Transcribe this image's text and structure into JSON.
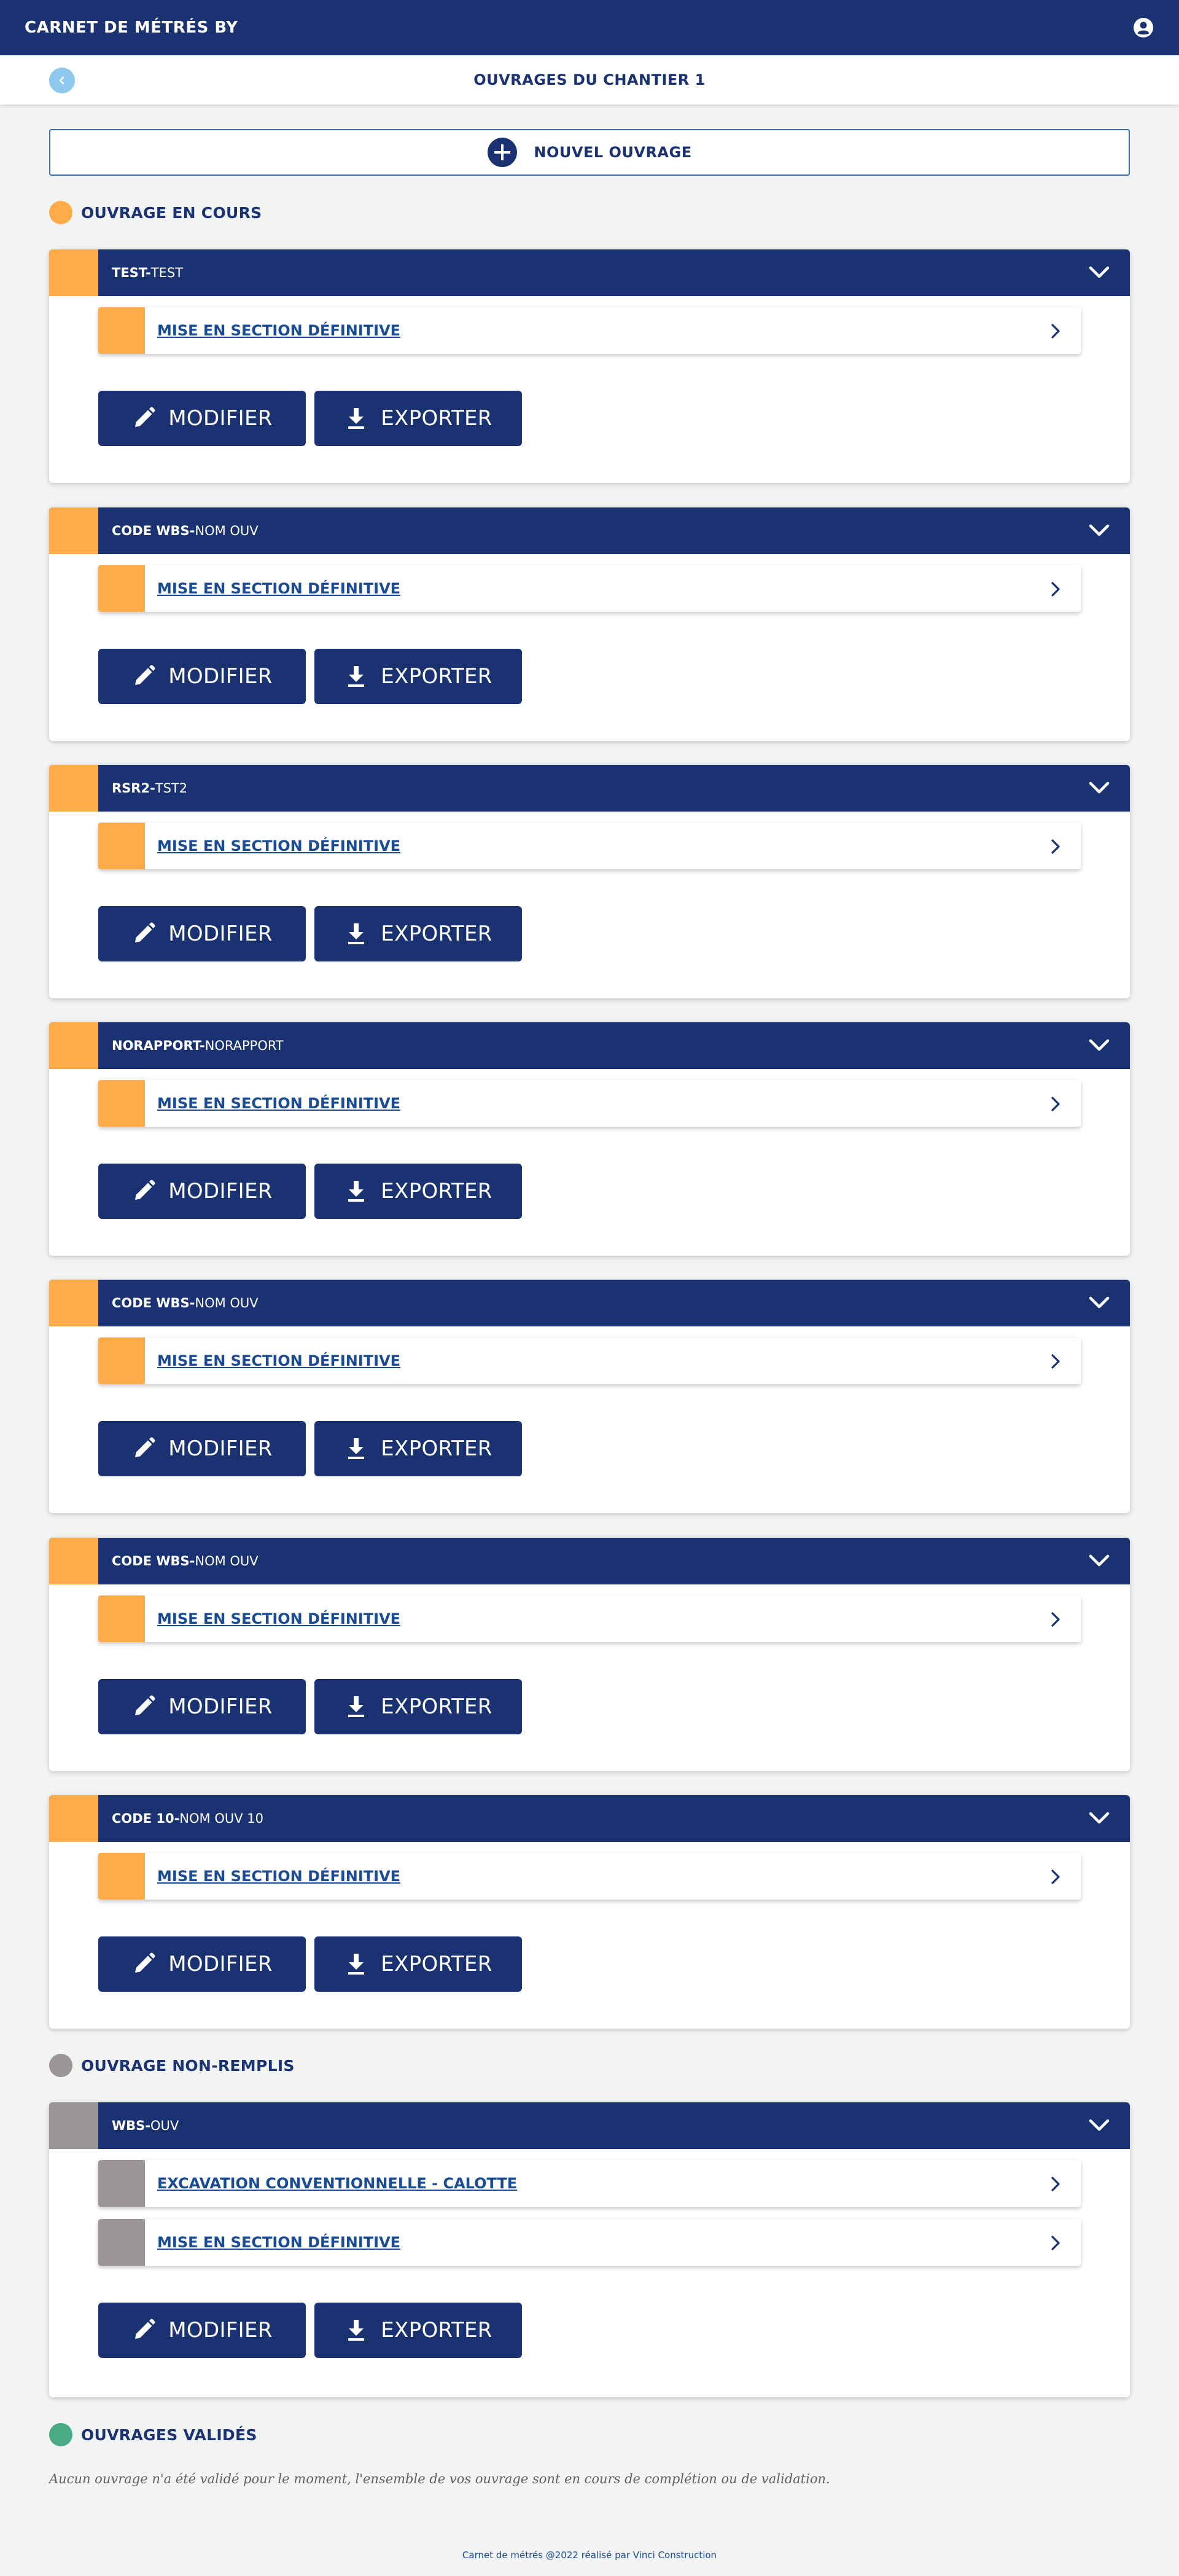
{
  "app": {
    "title": "CARNET DE MÉTRÉS BY"
  },
  "subheader": {
    "title": "OUVRAGES DU CHANTIER 1"
  },
  "new_ouvrage": {
    "label": "NOUVEL OUVRAGE"
  },
  "colors": {
    "primary": "#1a3272",
    "in_progress": "#ffab48",
    "empty": "#9b9595",
    "validated": "#4aaa85",
    "back": "#8ec8ee"
  },
  "sections": {
    "in_progress": {
      "title": "OUVRAGE EN COURS",
      "cards": [
        {
          "code": "TEST",
          "sep": "-",
          "name": "TEST",
          "steps": [
            "MISE EN SECTION DÉFINITIVE"
          ],
          "modify_label": "MODIFIER",
          "export_label": "EXPORTER"
        },
        {
          "code": "CODE WBS",
          "sep": "-",
          "name": "NOM OUV",
          "steps": [
            "MISE EN SECTION DÉFINITIVE"
          ],
          "modify_label": "MODIFIER",
          "export_label": "EXPORTER"
        },
        {
          "code": "RSR2",
          "sep": "-",
          "name": "TST2",
          "steps": [
            "MISE EN SECTION DÉFINITIVE"
          ],
          "modify_label": "MODIFIER",
          "export_label": "EXPORTER"
        },
        {
          "code": "NORAPPORT",
          "sep": "-",
          "name": "NORAPPORT",
          "steps": [
            "MISE EN SECTION DÉFINITIVE"
          ],
          "modify_label": "MODIFIER",
          "export_label": "EXPORTER"
        },
        {
          "code": "CODE WBS",
          "sep": "-",
          "name": "NOM OUV",
          "steps": [
            "MISE EN SECTION DÉFINITIVE"
          ],
          "modify_label": "MODIFIER",
          "export_label": "EXPORTER"
        },
        {
          "code": "CODE WBS",
          "sep": "-",
          "name": "NOM OUV",
          "steps": [
            "MISE EN SECTION DÉFINITIVE"
          ],
          "modify_label": "MODIFIER",
          "export_label": "EXPORTER"
        },
        {
          "code": "CODE 10",
          "sep": "-",
          "name": "NOM OUV 10",
          "steps": [
            "MISE EN SECTION DÉFINITIVE"
          ],
          "modify_label": "MODIFIER",
          "export_label": "EXPORTER"
        }
      ]
    },
    "non_remplis": {
      "title": "OUVRAGE NON-REMPLIS",
      "cards": [
        {
          "code": "WBS",
          "sep": "-",
          "name": "OUV",
          "steps": [
            "EXCAVATION CONVENTIONNELLE - CALOTTE",
            "MISE EN SECTION DÉFINITIVE"
          ],
          "modify_label": "MODIFIER",
          "export_label": "EXPORTER"
        }
      ]
    },
    "validated": {
      "title": "OUVRAGES VALIDÉS",
      "empty_message": "Aucun ouvrage n'a été validé pour le moment, l'ensemble de vos ouvrage sont en cours de complétion ou de validation."
    }
  },
  "footer": {
    "text": "Carnet de métrés @2022 réalisé par Vinci Construction"
  }
}
